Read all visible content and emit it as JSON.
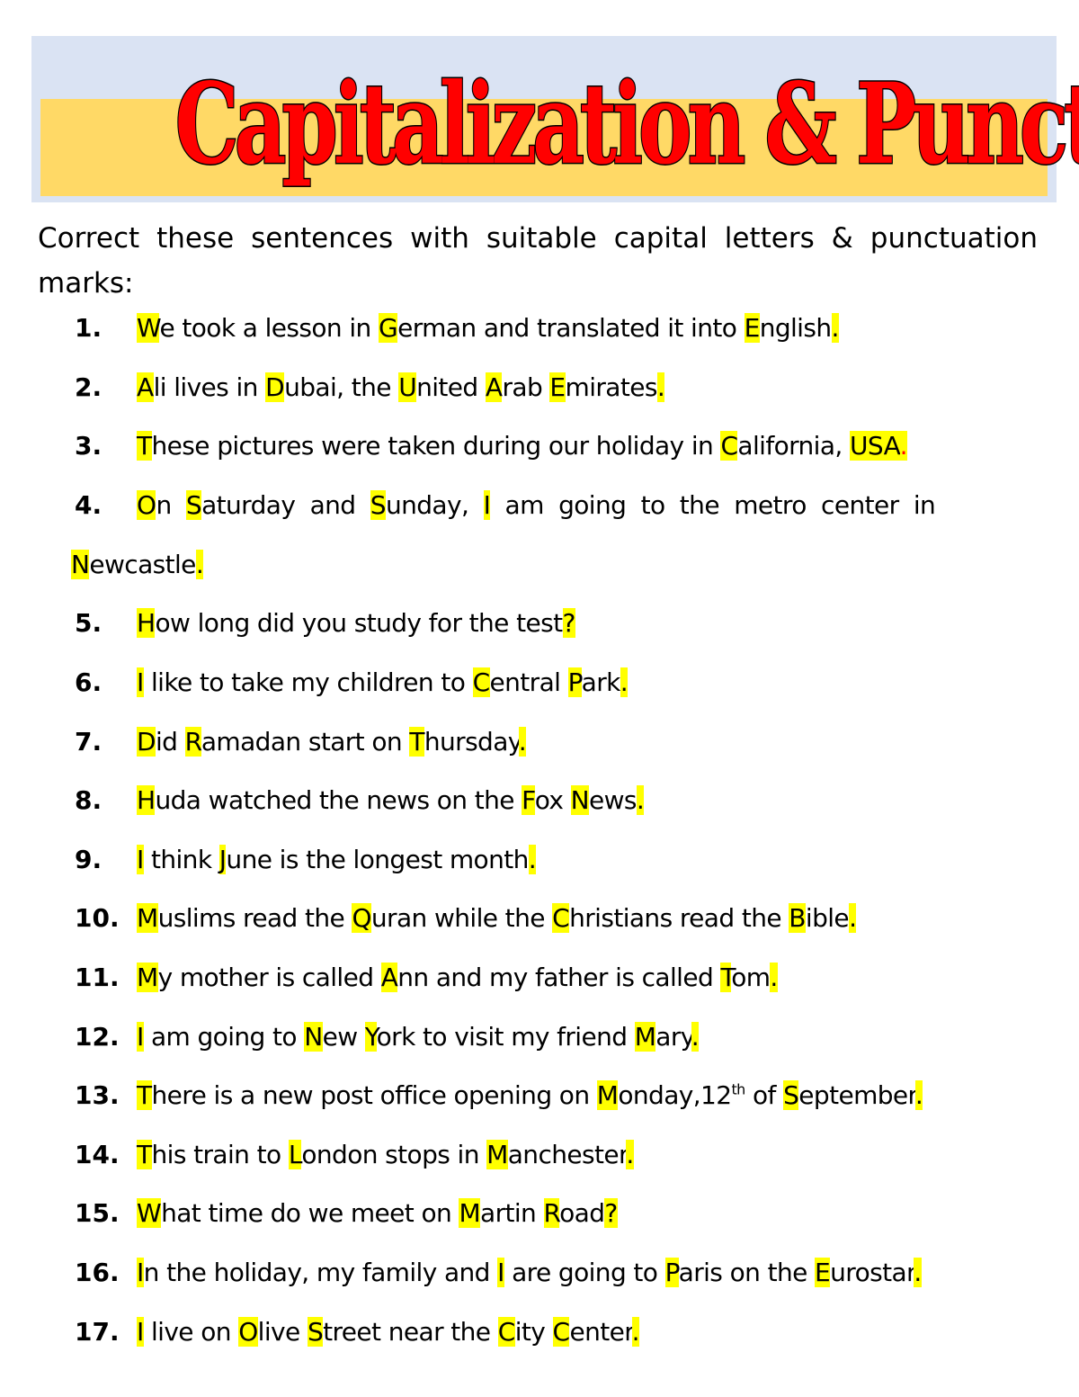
{
  "title": "Capitalization & Punctuation",
  "instructions": "Correct these sentences with suitable capital letters & punctuation marks:",
  "colors": {
    "highlight": "#ffff00",
    "title_fill": "#ff0000",
    "banner_bg": "#dae3f3",
    "banner_band": "#ffd966",
    "red_mark": "#ff0000"
  },
  "sentences": [
    {
      "num": "1.",
      "segments": [
        {
          "t": "W",
          "h": true
        },
        {
          "t": "e took a lesson in "
        },
        {
          "t": "G",
          "h": true
        },
        {
          "t": "erman and translated it into "
        },
        {
          "t": "E",
          "h": true
        },
        {
          "t": "nglish"
        },
        {
          "t": ".",
          "h": true
        }
      ]
    },
    {
      "num": "2.",
      "segments": [
        {
          "t": "A",
          "h": true
        },
        {
          "t": "li lives in "
        },
        {
          "t": "D",
          "h": true
        },
        {
          "t": "ubai, the "
        },
        {
          "t": "U",
          "h": true
        },
        {
          "t": "nited "
        },
        {
          "t": "A",
          "h": true
        },
        {
          "t": "rab "
        },
        {
          "t": "E",
          "h": true
        },
        {
          "t": "mirates"
        },
        {
          "t": ".",
          "h": true
        }
      ]
    },
    {
      "num": "3.",
      "segments": [
        {
          "t": "T",
          "h": true
        },
        {
          "t": "hese pictures were taken during our holiday in "
        },
        {
          "t": "C",
          "h": true
        },
        {
          "t": "alifornia, "
        },
        {
          "t": "USA",
          "h": true
        },
        {
          "t": ".",
          "h": true,
          "red": true
        }
      ]
    },
    {
      "num": "4.",
      "wrap": true,
      "segments": [
        {
          "t": "O",
          "h": true
        },
        {
          "t": "n "
        },
        {
          "t": "S",
          "h": true
        },
        {
          "t": "aturday and "
        },
        {
          "t": "S",
          "h": true
        },
        {
          "t": "unday, "
        },
        {
          "t": "I",
          "h": true
        },
        {
          "t": " am going to the metro center in "
        },
        {
          "t": "N",
          "h": true,
          "cont": true
        },
        {
          "t": "ewcastle"
        },
        {
          "t": ".",
          "h": true
        }
      ]
    },
    {
      "num": "5.",
      "segments": [
        {
          "t": "H",
          "h": true
        },
        {
          "t": "ow long did you study for the test"
        },
        {
          "t": "?",
          "h": true
        }
      ]
    },
    {
      "num": "6.",
      "segments": [
        {
          "t": "I",
          "h": true
        },
        {
          "t": " like to take my children to "
        },
        {
          "t": "C",
          "h": true
        },
        {
          "t": "entral "
        },
        {
          "t": "P",
          "h": true
        },
        {
          "t": "ark"
        },
        {
          "t": ".",
          "h": true
        }
      ]
    },
    {
      "num": "7.",
      "segments": [
        {
          "t": "D",
          "h": true
        },
        {
          "t": "id "
        },
        {
          "t": "R",
          "h": true
        },
        {
          "t": "amadan start on "
        },
        {
          "t": "T",
          "h": true
        },
        {
          "t": "hursday"
        },
        {
          "t": ".",
          "h": true
        }
      ]
    },
    {
      "num": "8.",
      "segments": [
        {
          "t": "H",
          "h": true
        },
        {
          "t": "uda watched the news on the "
        },
        {
          "t": "F",
          "h": true
        },
        {
          "t": "ox "
        },
        {
          "t": "N",
          "h": true
        },
        {
          "t": "ews"
        },
        {
          "t": ".",
          "h": true
        }
      ]
    },
    {
      "num": "9.",
      "segments": [
        {
          "t": "I",
          "h": true
        },
        {
          "t": " think "
        },
        {
          "t": "J",
          "h": true
        },
        {
          "t": "une is the longest month"
        },
        {
          "t": ".",
          "h": true
        }
      ]
    },
    {
      "num": "10.",
      "segments": [
        {
          "t": "M",
          "h": true
        },
        {
          "t": "uslims read the "
        },
        {
          "t": "Q",
          "h": true
        },
        {
          "t": "uran while the "
        },
        {
          "t": "C",
          "h": true
        },
        {
          "t": "hristians read the "
        },
        {
          "t": "B",
          "h": true
        },
        {
          "t": "ible"
        },
        {
          "t": ".",
          "h": true
        }
      ]
    },
    {
      "num": "11.",
      "segments": [
        {
          "t": "M",
          "h": true
        },
        {
          "t": "y mother is called "
        },
        {
          "t": "A",
          "h": true
        },
        {
          "t": "nn and my father is called "
        },
        {
          "t": "T",
          "h": true
        },
        {
          "t": "om"
        },
        {
          "t": ".",
          "h": true
        }
      ]
    },
    {
      "num": "12.",
      "segments": [
        {
          "t": "I",
          "h": true
        },
        {
          "t": " am going to "
        },
        {
          "t": "N",
          "h": true
        },
        {
          "t": "ew "
        },
        {
          "t": "Y",
          "h": true
        },
        {
          "t": "ork to visit my friend "
        },
        {
          "t": "M",
          "h": true
        },
        {
          "t": "ary"
        },
        {
          "t": ".",
          "h": true
        }
      ]
    },
    {
      "num": "13.",
      "segments": [
        {
          "t": "T",
          "h": true
        },
        {
          "t": "here is a new post office opening on "
        },
        {
          "t": "M",
          "h": true
        },
        {
          "t": "onday,12"
        },
        {
          "t": "th",
          "sup": true
        },
        {
          "t": " of "
        },
        {
          "t": "S",
          "h": true
        },
        {
          "t": "eptember"
        },
        {
          "t": ".",
          "h": true
        }
      ]
    },
    {
      "num": "14.",
      "segments": [
        {
          "t": "T",
          "h": true
        },
        {
          "t": "his train to "
        },
        {
          "t": "L",
          "h": true
        },
        {
          "t": "ondon stops in "
        },
        {
          "t": "M",
          "h": true
        },
        {
          "t": "anchester"
        },
        {
          "t": ".",
          "h": true
        }
      ]
    },
    {
      "num": "15.",
      "segments": [
        {
          "t": "W",
          "h": true
        },
        {
          "t": "hat time do we meet on "
        },
        {
          "t": "M",
          "h": true
        },
        {
          "t": "artin "
        },
        {
          "t": "R",
          "h": true
        },
        {
          "t": "oad"
        },
        {
          "t": "?",
          "h": true
        }
      ]
    },
    {
      "num": "16.",
      "segments": [
        {
          "t": "I",
          "h": true
        },
        {
          "t": "n the holiday, my family and "
        },
        {
          "t": "I",
          "h": true
        },
        {
          "t": " are going to "
        },
        {
          "t": "P",
          "h": true
        },
        {
          "t": "aris on the "
        },
        {
          "t": "E",
          "h": true
        },
        {
          "t": "urostar"
        },
        {
          "t": ".",
          "h": true
        }
      ]
    },
    {
      "num": "17.",
      "segments": [
        {
          "t": "I",
          "h": true
        },
        {
          "t": " live on "
        },
        {
          "t": "O",
          "h": true
        },
        {
          "t": "live "
        },
        {
          "t": "S",
          "h": true
        },
        {
          "t": "treet near the "
        },
        {
          "t": "C",
          "h": true
        },
        {
          "t": "ity "
        },
        {
          "t": "C",
          "h": true
        },
        {
          "t": "enter"
        },
        {
          "t": ".",
          "h": true
        }
      ]
    }
  ]
}
